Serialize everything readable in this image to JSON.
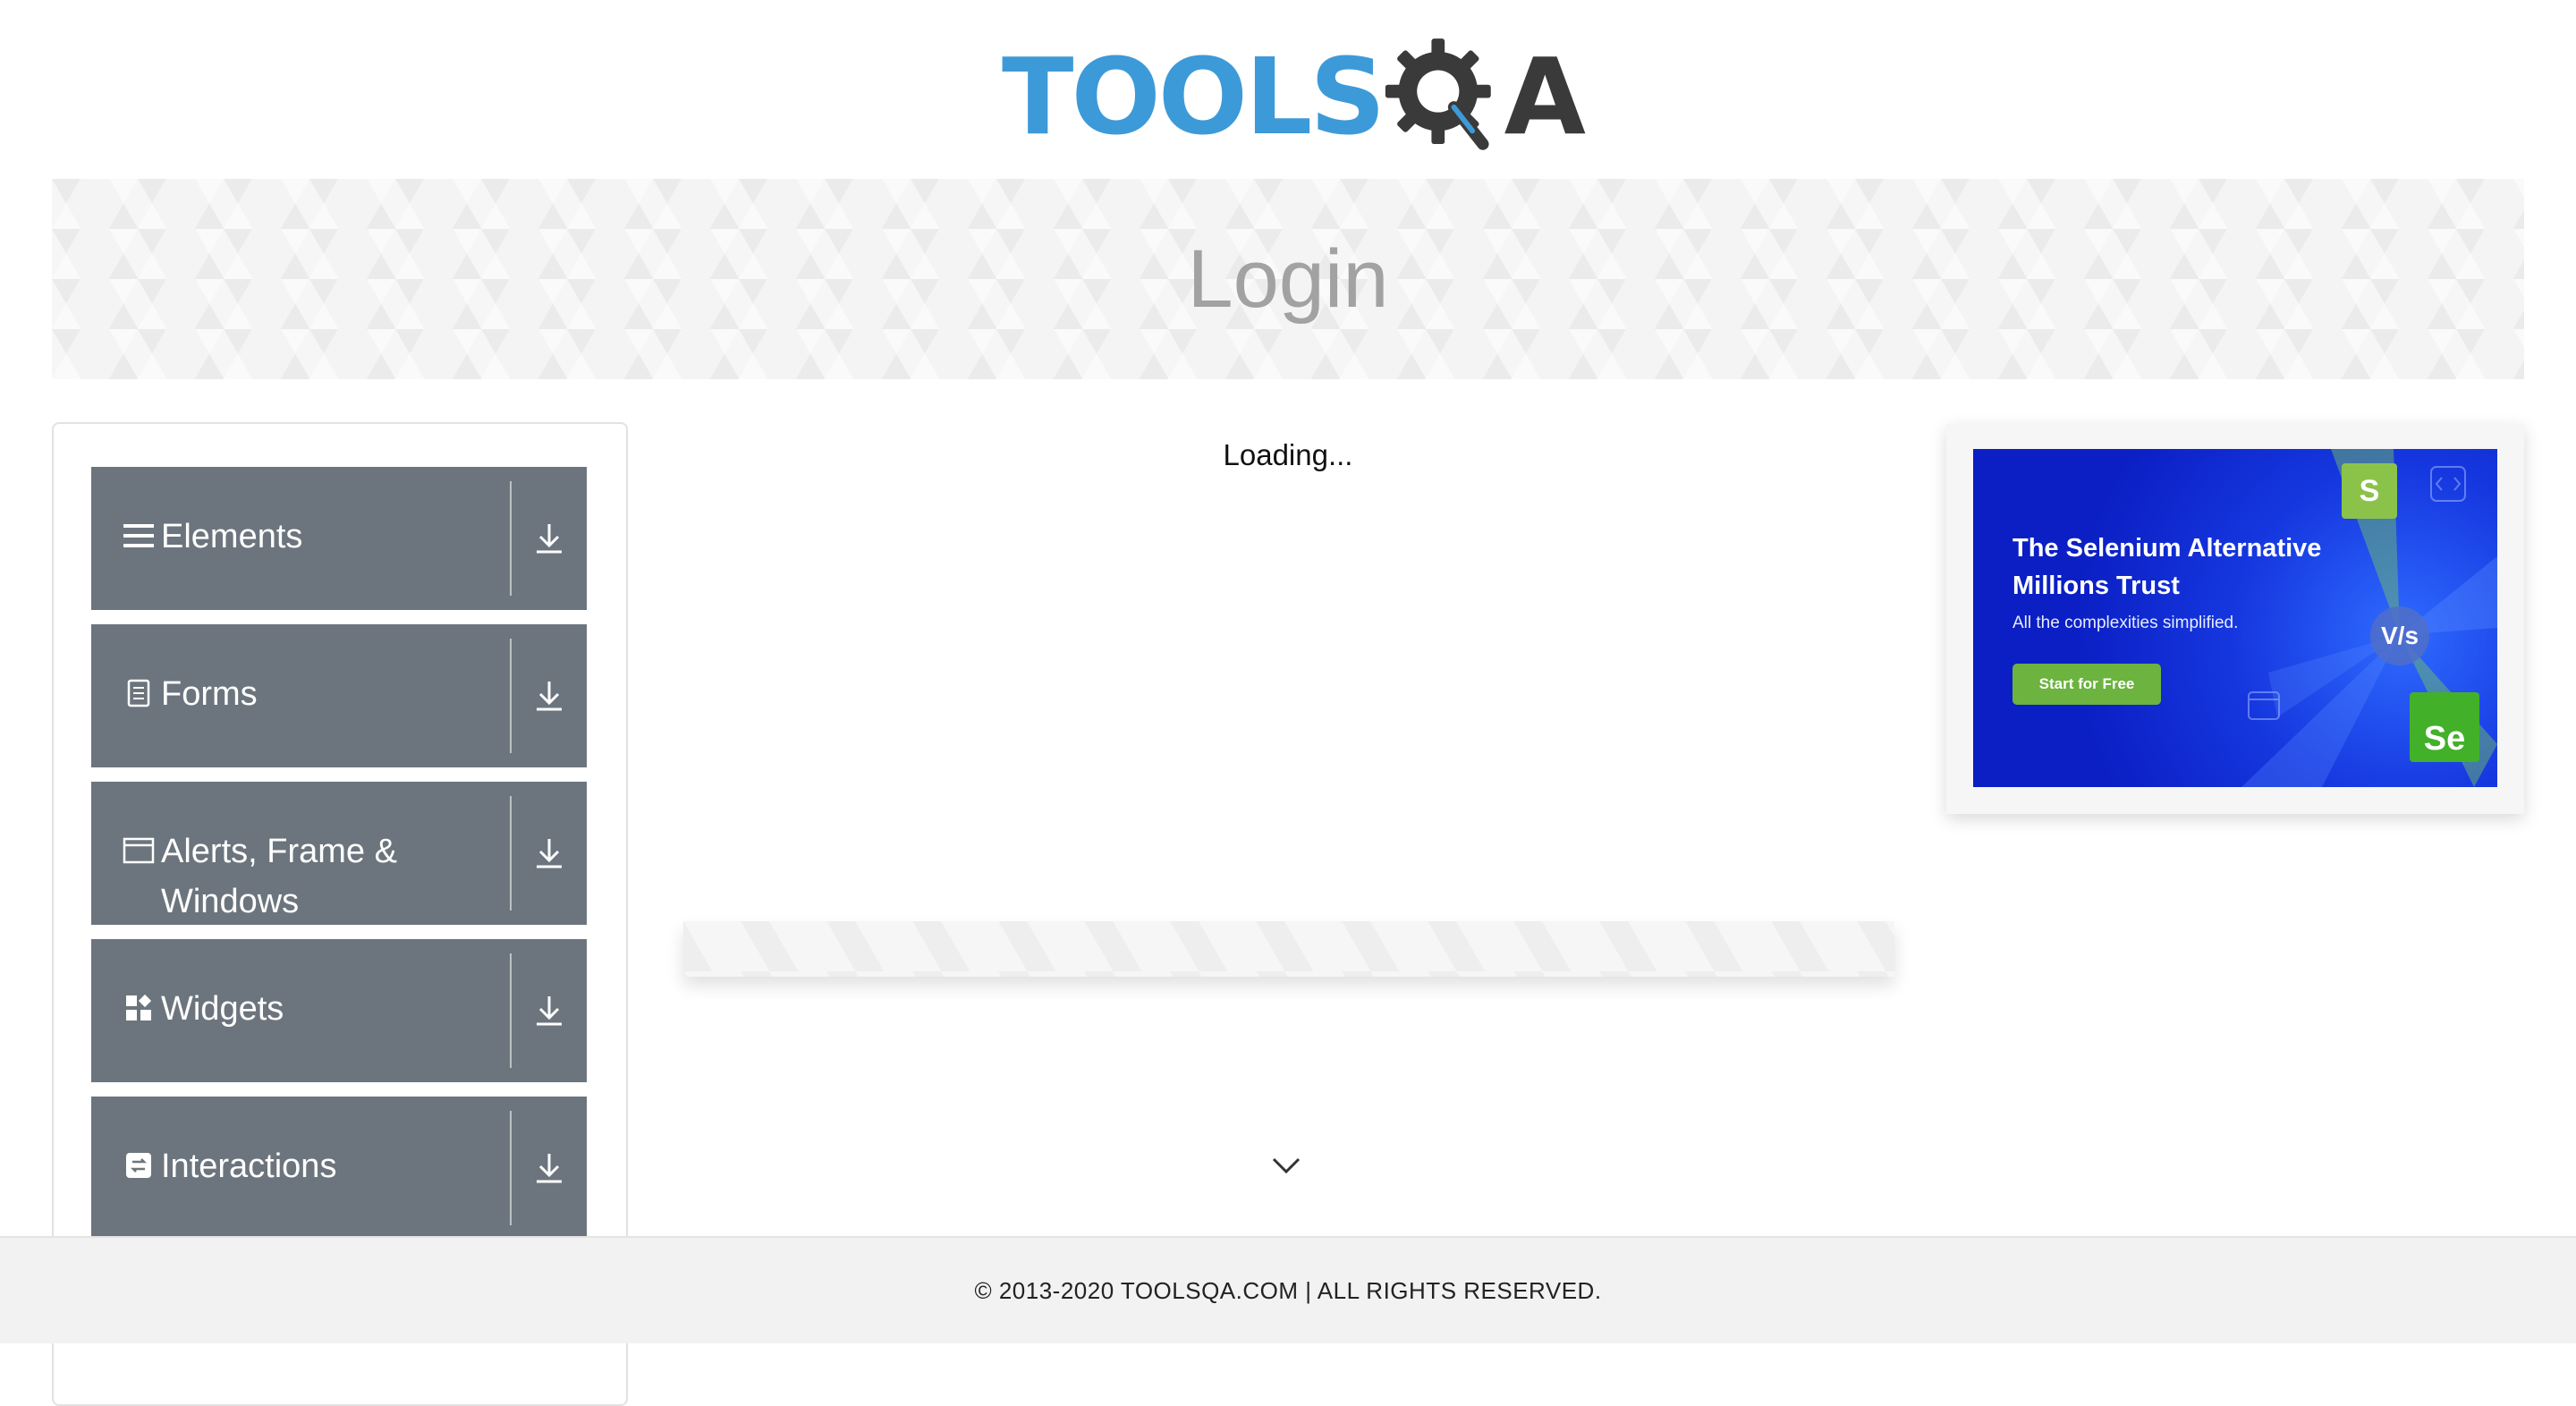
{
  "header": {
    "logo_text_tools": "TOOLS",
    "logo_text_a": "A",
    "logo_icon": "gear-magnifier-icon",
    "brand_blue": "#3d9ad8",
    "brand_dark": "#3a3a3a"
  },
  "banner": {
    "title": "Login"
  },
  "menu": {
    "groups": [
      {
        "label": "Elements",
        "icon": "hamburger-icon"
      },
      {
        "label": "Forms",
        "icon": "document-icon"
      },
      {
        "label": "Alerts, Frame & Windows",
        "icon": "window-icon"
      },
      {
        "label": "Widgets",
        "icon": "widgets-icon"
      },
      {
        "label": "Interactions",
        "icon": "swap-icon"
      }
    ],
    "toggle_icon": "download-arrow-icon",
    "header_color": "#6c757d"
  },
  "main": {
    "loading_text": "Loading..."
  },
  "ad": {
    "headline": "The Selenium Alternative Millions Trust",
    "subtext": "All the complexities simplified.",
    "cta_label": "Start for Free",
    "badge_s": "S",
    "badge_vs": "V/s",
    "badge_se": "Se",
    "bg_color": "#0b1fc4",
    "cta_color": "#6cb33f"
  },
  "footer": {
    "copyright": "© 2013-2020 TOOLSQA.COM | ALL RIGHTS RESERVED."
  }
}
